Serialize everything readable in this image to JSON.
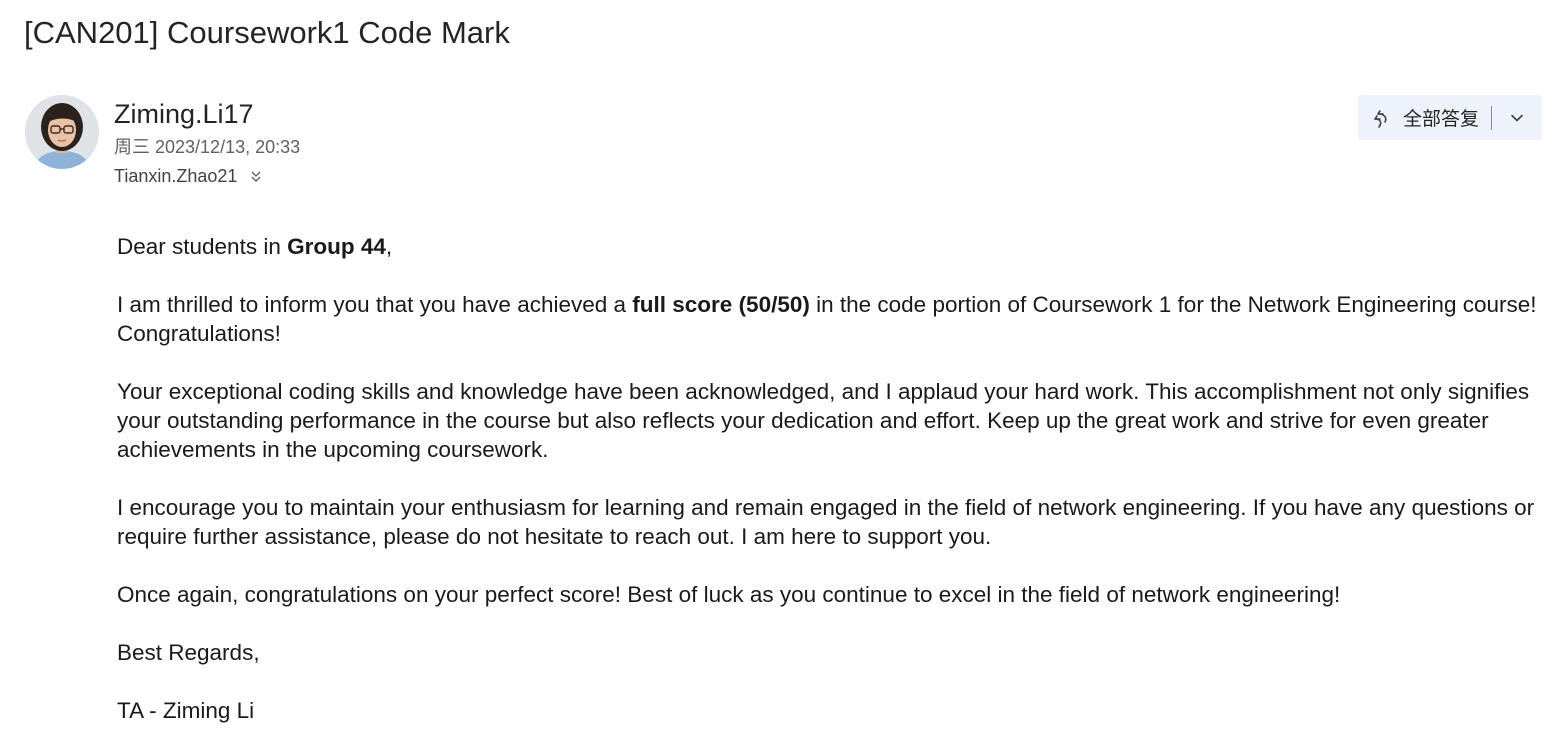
{
  "email": {
    "subject": "[CAN201] Coursework1 Code Mark",
    "sender": {
      "name": "Ziming.Li17",
      "date": "周三 2023/12/13, 20:33",
      "avatar_icon": "person-photo"
    },
    "recipient": "Tianxin.Zhao21",
    "actions": {
      "reply_all_label": "全部答复",
      "reply_all_icon": "reply-all-icon",
      "dropdown_icon": "chevron-down-icon"
    },
    "body": {
      "greeting_prefix": "Dear students in ",
      "greeting_group": "Group 44",
      "greeting_suffix": ",",
      "p1_prefix": "I am thrilled to inform you that you have achieved a ",
      "p1_bold": "full score (50/50)",
      "p1_suffix": " in the code portion of Coursework 1 for the Network Engineering course! Congratulations!",
      "p2": "Your exceptional coding skills and knowledge have been acknowledged, and I applaud your hard work. This accomplishment not only signifies your outstanding performance in the course but also reflects your dedication and effort. Keep up the great work and strive for even greater achievements in the upcoming coursework.",
      "p3": "I encourage you to maintain your enthusiasm for learning and remain engaged in the field of network engineering. If you have any questions or require further assistance, please do not hesitate to reach out. I am here to support you.",
      "p4": "Once again, congratulations on your perfect score! Best of luck as you continue to excel in the field of network engineering!",
      "closing": "Best Regards,",
      "signature": "TA - Ziming Li"
    }
  },
  "colors": {
    "text": "#242424",
    "muted": "#616161",
    "reply_bg": "#eef3fb"
  }
}
